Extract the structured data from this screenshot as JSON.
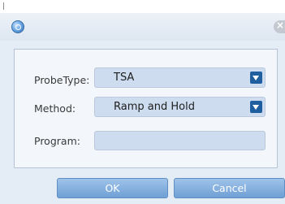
{
  "dialog": {
    "icon": "app-globe-icon",
    "close_icon": "close-icon"
  },
  "form": {
    "probe_type": {
      "label": "ProbeType:",
      "value": "TSA"
    },
    "method": {
      "label": "Method:",
      "value": "Ramp and Hold"
    },
    "program": {
      "label": "Program:",
      "value": ""
    }
  },
  "buttons": {
    "ok": "OK",
    "cancel": "Cancel"
  },
  "colors": {
    "dialog_bg": "#e4ecf6",
    "field_bg": "#cddcee",
    "dropdown_arrow": "#1f5fa0",
    "button": "#7fabd9"
  }
}
